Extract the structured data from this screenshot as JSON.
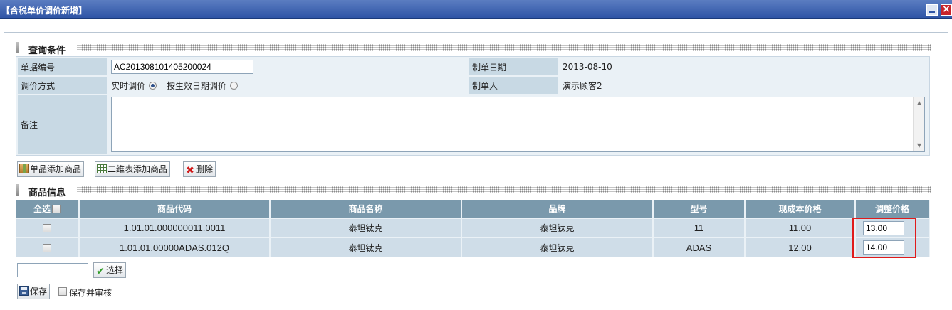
{
  "window": {
    "title": "【含税单价调价新增】"
  },
  "query_section": {
    "title": "查询条件"
  },
  "form": {
    "doc_no_label": "单据编号",
    "doc_no_value": "AC201308101405200024",
    "date_label": "制单日期",
    "date_value": "2013-08-10",
    "method_label": "调价方式",
    "method_option_realtime": "实时调价",
    "method_option_effective": "按生效日期调价",
    "maker_label": "制单人",
    "maker_value": "演示顾客2",
    "remark_label": "备注"
  },
  "toolbar": {
    "add_single": "单品添加商品",
    "add_matrix": "二维表添加商品",
    "delete": "删除"
  },
  "goods_section": {
    "title": "商品信息"
  },
  "grid": {
    "columns": {
      "select_all": "全选",
      "code": "商品代码",
      "name": "商品名称",
      "brand": "品牌",
      "model": "型号",
      "cost": "现成本价格",
      "adjust": "调整价格"
    },
    "rows": [
      {
        "code": "1.01.01.000000011.0011",
        "name": "泰坦钛克",
        "brand": "泰坦钛克",
        "model": "11",
        "cost": "11.00",
        "adjust": "13.00"
      },
      {
        "code": "1.01.01.00000ADAS.012Q",
        "name": "泰坦钛克",
        "brand": "泰坦钛克",
        "model": "ADAS",
        "cost": "12.00",
        "adjust": "14.00"
      }
    ]
  },
  "select_button": "选择",
  "save_button": "保存",
  "save_and_approve": "保存并审核"
}
